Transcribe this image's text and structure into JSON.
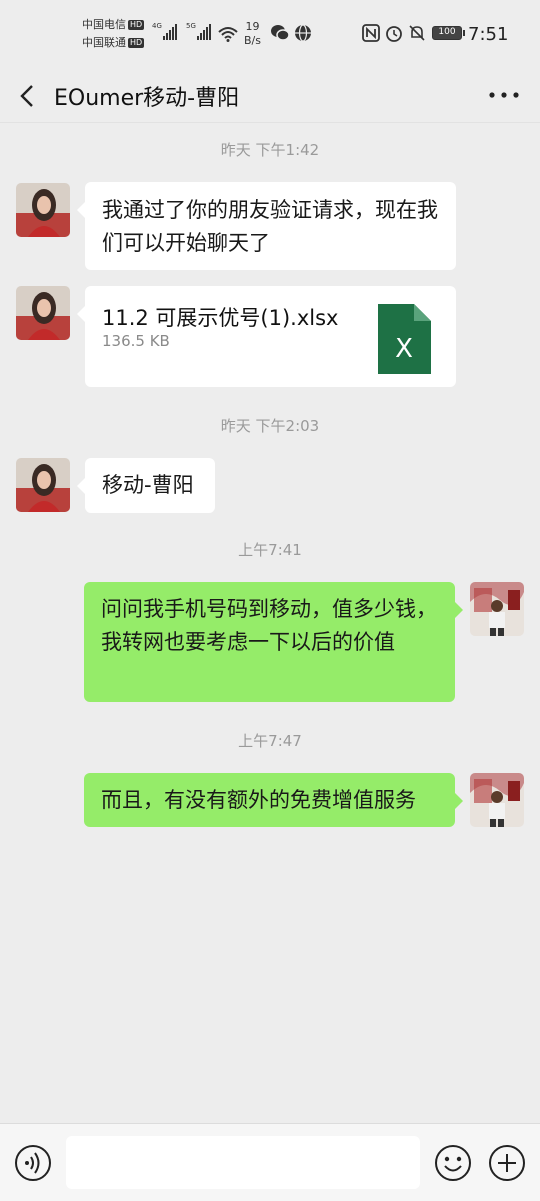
{
  "status_bar": {
    "carrier1": "中国电信",
    "carrier2": "中国联通",
    "hd": "HD",
    "net1": "4G",
    "net2": "5G",
    "speed_value": "19",
    "speed_unit": "B/s",
    "battery": "100",
    "time": "7:51"
  },
  "header": {
    "title": "EOumer移动-曹阳",
    "back_icon": "chevron-left-icon",
    "more_icon": "ellipsis-icon"
  },
  "messages": [
    {
      "type": "timestamp",
      "text": "昨天 下午1:42"
    },
    {
      "type": "text",
      "direction": "in",
      "text": "我通过了你的朋友验证请求，现在我们可以开始聊天了"
    },
    {
      "type": "file",
      "direction": "in",
      "file_name": "11.2 可展示优号(1).xlsx",
      "file_size": "136.5 KB",
      "file_icon_letter": "X"
    },
    {
      "type": "timestamp",
      "text": "昨天 下午2:03"
    },
    {
      "type": "text",
      "direction": "in",
      "text": "移动-曹阳"
    },
    {
      "type": "timestamp",
      "text": "上午7:41"
    },
    {
      "type": "text",
      "direction": "out",
      "text": "问问我手机号码到移动，值多少钱，我转网也要考虑一下以后的价值"
    },
    {
      "type": "timestamp",
      "text": "上午7:47"
    },
    {
      "type": "text",
      "direction": "out",
      "text": "而且，有没有额外的免费增值服务"
    }
  ],
  "input_bar": {
    "placeholder": "",
    "voice_icon": "voice-icon",
    "emoji_icon": "emoji-icon",
    "plus_icon": "plus-icon"
  },
  "colors": {
    "background": "#ededed",
    "outgoing_bubble": "#95ec69",
    "incoming_bubble": "#ffffff",
    "excel_green": "#1e7145"
  }
}
